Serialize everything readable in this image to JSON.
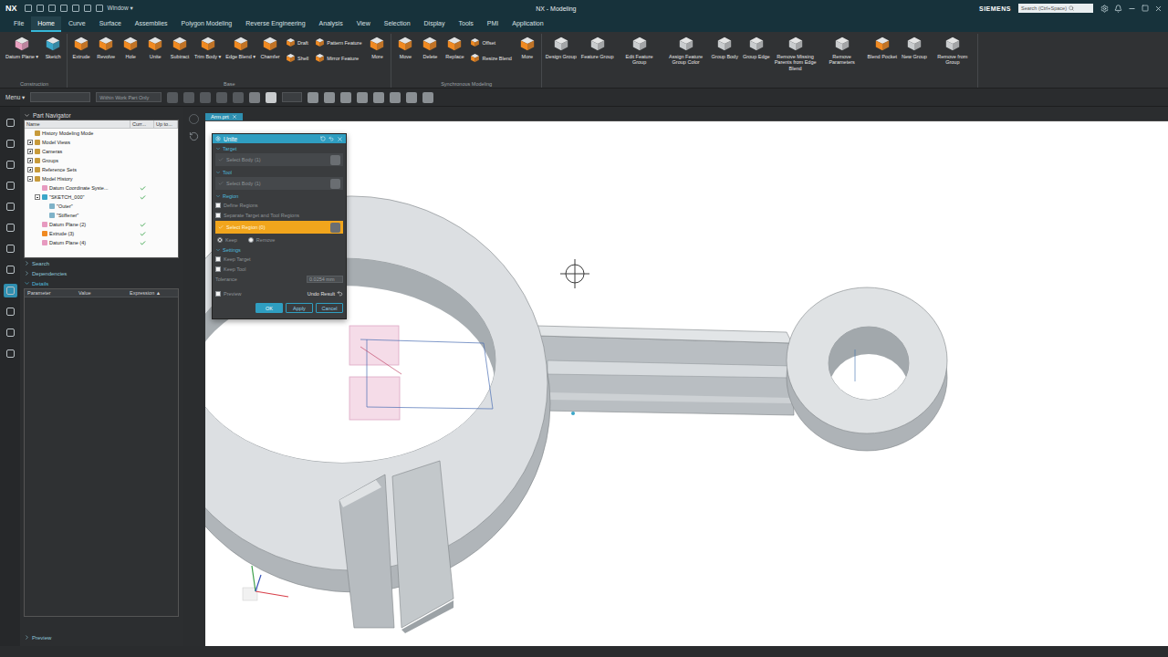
{
  "window": {
    "app": "NX",
    "quick_access": "Window ▾",
    "title": "NX - Modeling",
    "brand": "SIEMENS",
    "search_placeholder": "Search (Ctrl+Space)"
  },
  "menu_tabs": [
    {
      "label": "File",
      "selected": false
    },
    {
      "label": "Home",
      "selected": true
    },
    {
      "label": "Curve",
      "selected": false
    },
    {
      "label": "Surface",
      "selected": false
    },
    {
      "label": "Assemblies",
      "selected": false
    },
    {
      "label": "Polygon Modeling",
      "selected": false
    },
    {
      "label": "Reverse Engineering",
      "selected": false
    },
    {
      "label": "Analysis",
      "selected": false
    },
    {
      "label": "View",
      "selected": false
    },
    {
      "label": "Selection",
      "selected": false
    },
    {
      "label": "Display",
      "selected": false
    },
    {
      "label": "Tools",
      "selected": false
    },
    {
      "label": "PMI",
      "selected": false
    },
    {
      "label": "Application",
      "selected": false
    }
  ],
  "ribbon": {
    "groups": [
      {
        "label": "Construction",
        "items": [
          {
            "kind": "large",
            "label": "Datum Plane ▾"
          },
          {
            "kind": "large",
            "label": "Sketch"
          }
        ]
      },
      {
        "label": "Base",
        "items": [
          {
            "kind": "large",
            "label": "Extrude"
          },
          {
            "kind": "large",
            "label": "Revolve"
          },
          {
            "kind": "large",
            "label": "Hole"
          },
          {
            "kind": "large",
            "label": "Unite"
          },
          {
            "kind": "large",
            "label": "Subtract"
          },
          {
            "kind": "large",
            "label": "Trim Body ▾"
          },
          {
            "kind": "large",
            "label": "Edge Blend ▾"
          },
          {
            "kind": "large",
            "label": "Chamfer"
          },
          {
            "kind": "stack",
            "labels": [
              "Draft",
              "Shell"
            ]
          },
          {
            "kind": "stack",
            "labels": [
              "Pattern Feature",
              "Mirror Feature"
            ]
          },
          {
            "kind": "large",
            "label": "More"
          }
        ]
      },
      {
        "label": "Synchronous Modeling",
        "items": [
          {
            "kind": "large",
            "label": "Move"
          },
          {
            "kind": "large",
            "label": "Delete"
          },
          {
            "kind": "large",
            "label": "Replace"
          },
          {
            "kind": "stack",
            "labels": [
              "Offset",
              "Resize Blend"
            ]
          },
          {
            "kind": "large",
            "label": "More"
          }
        ]
      },
      {
        "items": [
          {
            "kind": "large",
            "label": "Design Group"
          },
          {
            "kind": "large",
            "label": "Feature Group"
          },
          {
            "kind": "large",
            "label": "Edit Feature Group"
          },
          {
            "kind": "large",
            "label": "Assign Feature Group Color"
          },
          {
            "kind": "large",
            "label": "Group Body"
          },
          {
            "kind": "large",
            "label": "Group Edge"
          },
          {
            "kind": "large",
            "label": "Remove Missing Parents from Edge Blend"
          },
          {
            "kind": "large",
            "label": "Remove Parameters"
          },
          {
            "kind": "large",
            "label": "Blend Pocket"
          },
          {
            "kind": "large",
            "label": "New Group"
          },
          {
            "kind": "large",
            "label": "Remove from Group"
          }
        ]
      }
    ]
  },
  "toolbar": {
    "menu": "Menu ▾",
    "filter": "Within Work Part Only"
  },
  "resource_bar": [
    {
      "selected": false
    },
    {
      "selected": false
    },
    {
      "selected": false
    },
    {
      "selected": false
    },
    {
      "selected": false
    },
    {
      "selected": false
    },
    {
      "selected": false
    },
    {
      "selected": false
    },
    {
      "selected": true
    },
    {
      "selected": false
    },
    {
      "selected": false
    },
    {
      "selected": false
    }
  ],
  "document_tabs": [
    {
      "label": "Arm.prt",
      "selected": true
    }
  ],
  "part_navigator": {
    "title": "Part Navigator",
    "columns": [
      "Name",
      "Curr...",
      "Up to..."
    ],
    "rows": [
      {
        "label": "History Modeling Mode",
        "depth": 0,
        "expandable": false,
        "expanded": false,
        "checked": false
      },
      {
        "label": "Model Views",
        "depth": 0,
        "expandable": true,
        "expanded": false,
        "checked": false
      },
      {
        "label": "Cameras",
        "depth": 0,
        "expandable": true,
        "expanded": false,
        "checked": false
      },
      {
        "label": "Groups",
        "depth": 0,
        "expandable": true,
        "expanded": false,
        "checked": false
      },
      {
        "label": "Reference Sets",
        "depth": 0,
        "expandable": true,
        "expanded": false,
        "checked": false
      },
      {
        "label": "Model History",
        "depth": 0,
        "expandable": true,
        "expanded": true,
        "checked": false
      },
      {
        "label": "Datum Coordinate Syste...",
        "depth": 1,
        "expandable": false,
        "expanded": false,
        "checked": true
      },
      {
        "label": "\"SKETCH_000\"",
        "depth": 1,
        "expandable": true,
        "expanded": true,
        "checked": true
      },
      {
        "label": "\"Outer\"",
        "depth": 2,
        "expandable": false,
        "expanded": false,
        "checked": false
      },
      {
        "label": "\"Stiffener\"",
        "depth": 2,
        "expandable": false,
        "expanded": false,
        "checked": false
      },
      {
        "label": "Datum Plane (2)",
        "depth": 1,
        "expandable": false,
        "expanded": false,
        "checked": true
      },
      {
        "label": "Extrude (3)",
        "depth": 1,
        "expandable": false,
        "expanded": false,
        "checked": true
      },
      {
        "label": "Datum Plane (4)",
        "depth": 1,
        "expandable": false,
        "expanded": false,
        "checked": true
      }
    ],
    "sections": [
      {
        "label": "Search",
        "expanded": false
      },
      {
        "label": "Dependencies",
        "expanded": false
      },
      {
        "label": "Details",
        "expanded": true
      }
    ],
    "details_columns": [
      "Parameter",
      "Value",
      "Expression ▲"
    ],
    "footer": {
      "label": "Preview",
      "expanded": false
    }
  },
  "dialog": {
    "title": "Unite",
    "sections": [
      {
        "label": "Target",
        "rows": [
          {
            "kind": "select",
            "label": "Select Body (1)",
            "done": true,
            "highlighted": false
          }
        ]
      },
      {
        "label": "Tool",
        "rows": [
          {
            "kind": "select",
            "label": "Select Body (1)",
            "done": true,
            "highlighted": false
          }
        ]
      },
      {
        "label": "Region",
        "rows": [
          {
            "kind": "checkbox",
            "label": "Define Regions",
            "checked": false
          },
          {
            "kind": "checkbox",
            "label": "Separate Target and Tool Regions",
            "checked": false
          },
          {
            "kind": "select",
            "label": "Select Region (0)",
            "done": true,
            "highlighted": true
          },
          {
            "kind": "radio",
            "options": [
              {
                "label": "Keep",
                "selected": true
              },
              {
                "label": "Remove",
                "selected": false
              }
            ]
          }
        ]
      },
      {
        "label": "Settings",
        "rows": [
          {
            "kind": "checkbox",
            "label": "Keep Target",
            "checked": false
          },
          {
            "kind": "checkbox",
            "label": "Keep Tool",
            "checked": false
          },
          {
            "kind": "field",
            "label": "Tolerance",
            "value": "0.0254 mm"
          }
        ]
      }
    ],
    "preview": {
      "label": "Preview",
      "checked": false
    },
    "undo": "Undo Result",
    "buttons": [
      {
        "label": "OK",
        "primary": true
      },
      {
        "label": "Apply",
        "primary": false
      },
      {
        "label": "Cancel",
        "primary": false
      }
    ]
  }
}
